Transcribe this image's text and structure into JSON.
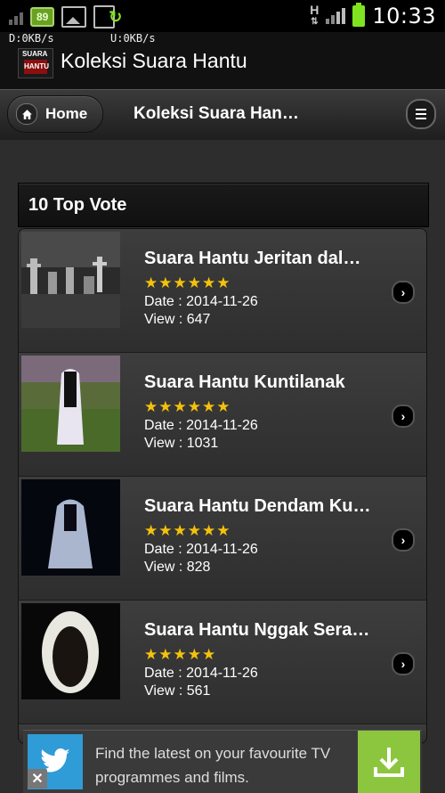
{
  "status": {
    "battery_level": "89",
    "network": "H",
    "time": "10:33"
  },
  "appbar": {
    "download_speed": "D:0KB/s",
    "upload_speed": "U:0KB/s",
    "icon_top_text": "SUARA",
    "icon_mid_text": "HANTU",
    "title": "Koleksi Suara Hantu"
  },
  "header": {
    "home_label": "Home",
    "title": "Koleksi Suara Han…"
  },
  "section": {
    "title": "10 Top Vote"
  },
  "items": [
    {
      "title": "Suara Hantu Jeritan dal…",
      "stars": "★★★★★★",
      "date": "Date : 2014-11-26",
      "view": "View : 647"
    },
    {
      "title": "Suara Hantu Kuntilanak",
      "stars": "★★★★★★",
      "date": "Date : 2014-11-26",
      "view": "View : 1031"
    },
    {
      "title": "Suara Hantu Dendam Ku…",
      "stars": "★★★★★★",
      "date": "Date : 2014-11-26",
      "view": "View : 828"
    },
    {
      "title": "Suara Hantu Nggak Sera…",
      "stars": "★★★★★",
      "date": "Date : 2014-11-26",
      "view": "View : 561"
    }
  ],
  "ad": {
    "text": "Find the latest on your favourite TV programmes and films.",
    "close": "✕"
  },
  "icons": {
    "home": "home-icon",
    "menu": "menu-icon",
    "chevron": "chevron-right-icon",
    "twitter": "twitter-icon",
    "download": "download-icon"
  },
  "colors": {
    "star": "#f4c20d",
    "battery": "#7fe321",
    "twitter": "#2f9bd7",
    "download": "#8cc63e"
  }
}
